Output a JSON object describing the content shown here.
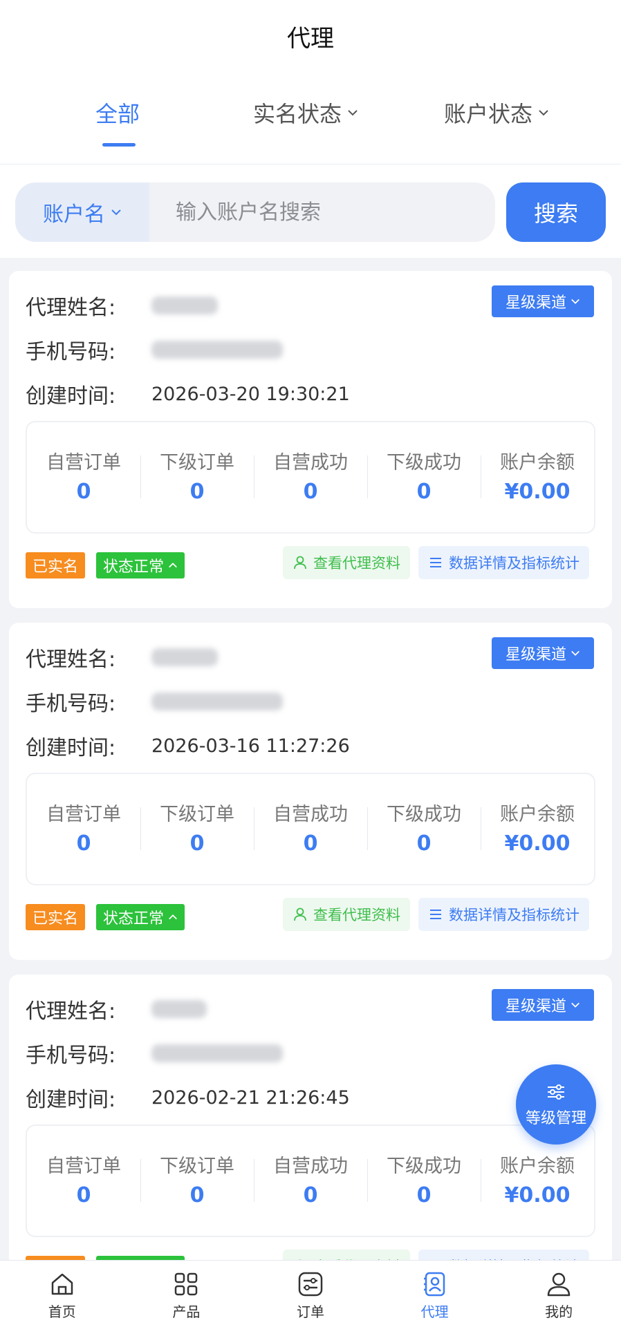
{
  "header": {
    "title": "代理"
  },
  "tabs": [
    {
      "label": "全部",
      "active": true
    },
    {
      "label": "实名状态",
      "active": false
    },
    {
      "label": "账户状态",
      "active": false
    }
  ],
  "search": {
    "field_label": "账户名",
    "placeholder": "输入账户名搜索",
    "button_label": "搜索"
  },
  "labels": {
    "agent_name": "代理姓名:",
    "phone": "手机号码:",
    "created": "创建时间:",
    "channel": "星级渠道",
    "stat_self_orders": "自营订单",
    "stat_sub_orders": "下级订单",
    "stat_self_success": "自营成功",
    "stat_sub_success": "下级成功",
    "stat_balance": "账户余额",
    "tag_verified": "已实名",
    "tag_status": "状态正常",
    "action_profile": "查看代理资料",
    "action_stats": "数据详情及指标统计"
  },
  "agents": [
    {
      "created": "2026-03-20 19:30:21",
      "self_orders": "0",
      "sub_orders": "0",
      "self_success": "0",
      "sub_success": "0",
      "balance": "¥0.00"
    },
    {
      "created": "2026-03-16 11:27:26",
      "self_orders": "0",
      "sub_orders": "0",
      "self_success": "0",
      "sub_success": "0",
      "balance": "¥0.00"
    },
    {
      "created": "2026-02-21 21:26:45",
      "self_orders": "0",
      "sub_orders": "0",
      "self_success": "0",
      "sub_success": "0",
      "balance": "¥0.00"
    }
  ],
  "fab": {
    "label": "等级管理",
    "icon": "sliders-icon"
  },
  "nav": [
    {
      "label": "首页",
      "icon": "home-icon",
      "active": false
    },
    {
      "label": "产品",
      "icon": "grid-icon",
      "active": false
    },
    {
      "label": "订单",
      "icon": "order-icon",
      "active": false
    },
    {
      "label": "代理",
      "icon": "agent-icon",
      "active": true
    },
    {
      "label": "我的",
      "icon": "user-icon",
      "active": false
    }
  ],
  "colors": {
    "accent": "#3d7cf2",
    "orange": "#f78c1f",
    "green": "#2cc23b"
  }
}
